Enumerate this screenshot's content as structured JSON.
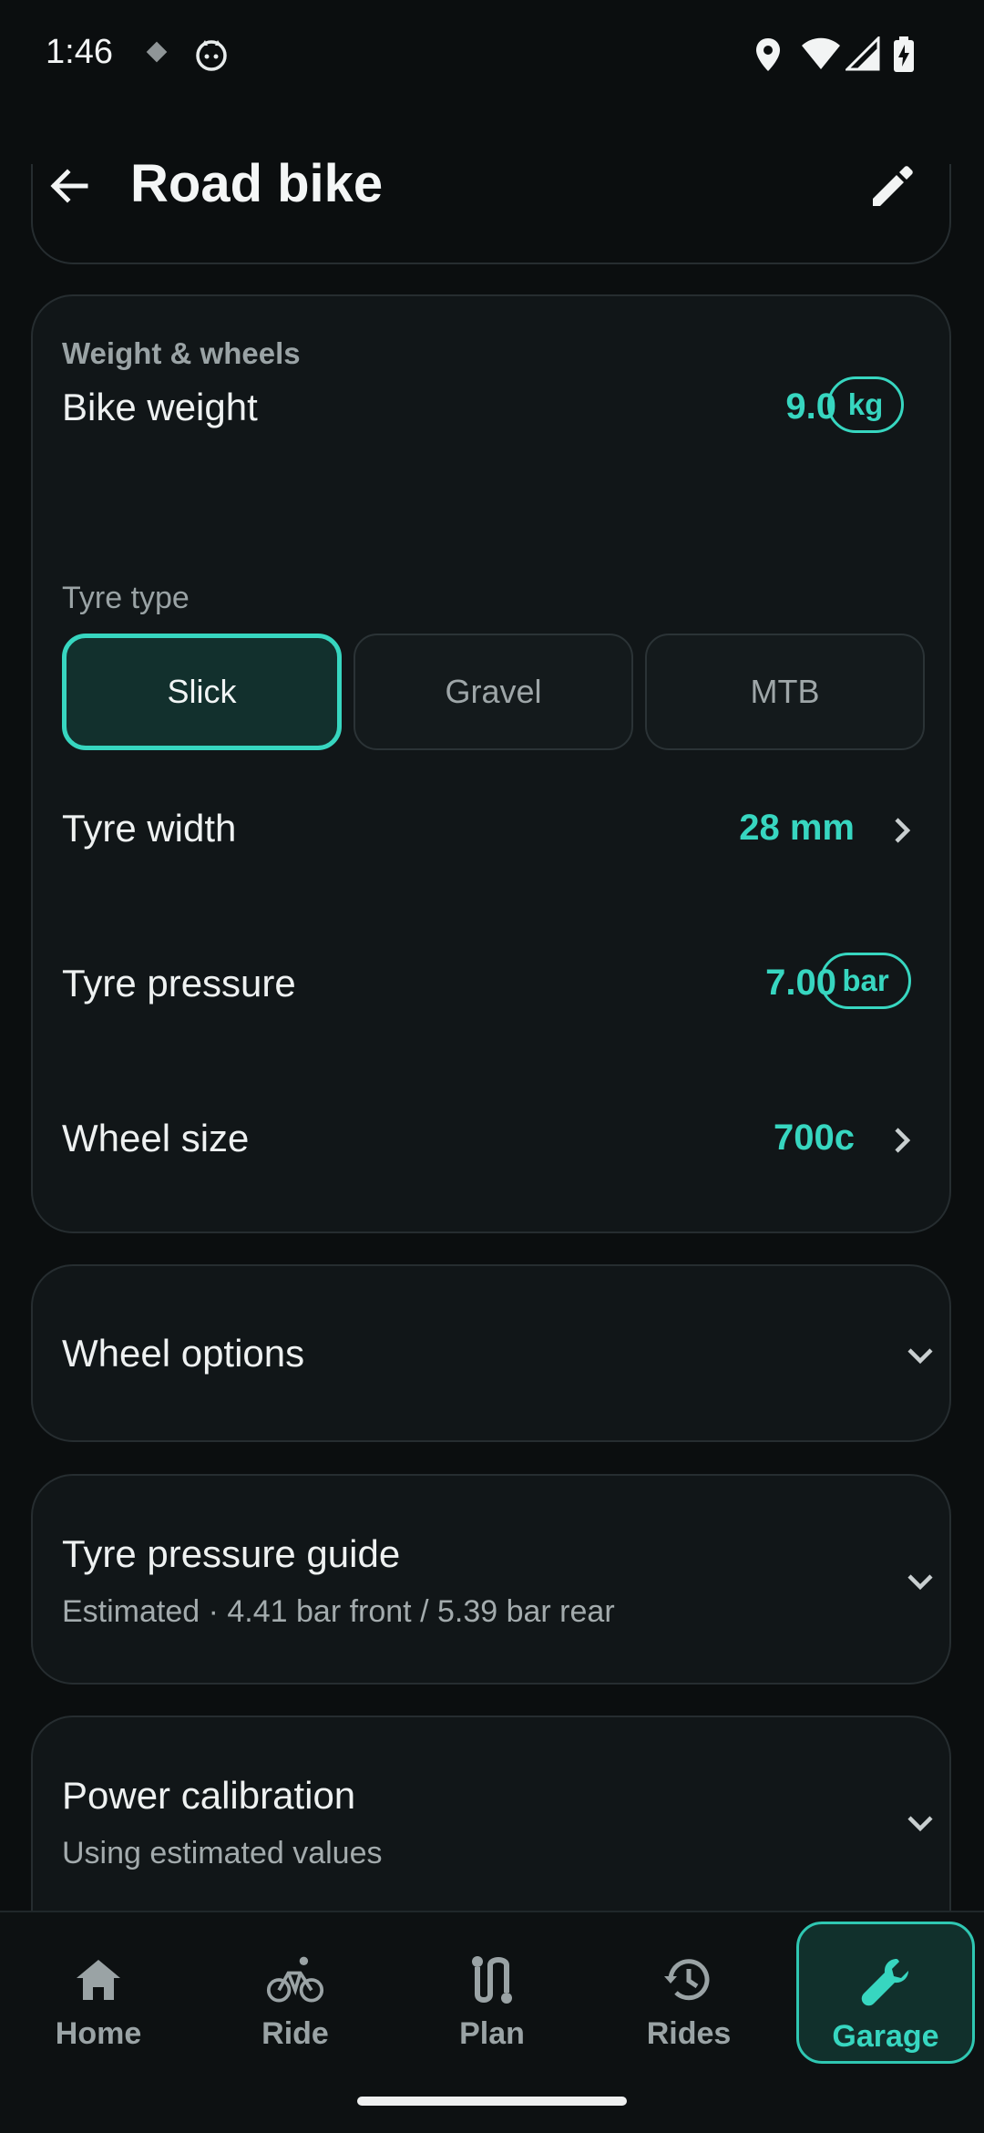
{
  "status_bar": {
    "time": "1:46",
    "icons": [
      "notification-diamond-icon",
      "cat-app-icon",
      "location-icon",
      "wifi-icon",
      "cell-signal-icon",
      "battery-charging-icon"
    ]
  },
  "app_bar": {
    "title": "Road bike",
    "back_icon": "arrow-back-icon",
    "edit_icon": "edit-pencil-icon"
  },
  "weight_wheels": {
    "section_label": "Weight & wheels",
    "bike_weight": {
      "label": "Bike weight",
      "value": "9.0",
      "unit": "kg"
    },
    "tyre_type": {
      "label": "Tyre type",
      "options": [
        "Slick",
        "Gravel",
        "MTB"
      ],
      "selected": "Slick"
    },
    "tyre_width": {
      "label": "Tyre width",
      "value": "28 mm"
    },
    "tyre_pressure": {
      "label": "Tyre pressure",
      "value": "7.00",
      "unit": "bar"
    },
    "wheel_size": {
      "label": "Wheel size",
      "value": "700c"
    }
  },
  "wheel_options": {
    "title": "Wheel options"
  },
  "tyre_pressure_guide": {
    "title": "Tyre pressure guide",
    "subtitle": "Estimated · 4.41 bar front / 5.39 bar rear"
  },
  "power_calibration": {
    "title": "Power calibration",
    "subtitle": "Using estimated values"
  },
  "bottom_nav": {
    "items": [
      {
        "label": "Home",
        "icon": "home-icon"
      },
      {
        "label": "Ride",
        "icon": "bicycle-icon"
      },
      {
        "label": "Plan",
        "icon": "route-icon"
      },
      {
        "label": "Rides",
        "icon": "history-icon"
      },
      {
        "label": "Garage",
        "icon": "wrench-icon"
      }
    ],
    "active": "Garage"
  },
  "colors": {
    "background": "#0b0e0f",
    "card": "#111618",
    "accent": "#37d6c0",
    "text_primary": "#eef1f1",
    "text_secondary": "#9aa3a5"
  }
}
